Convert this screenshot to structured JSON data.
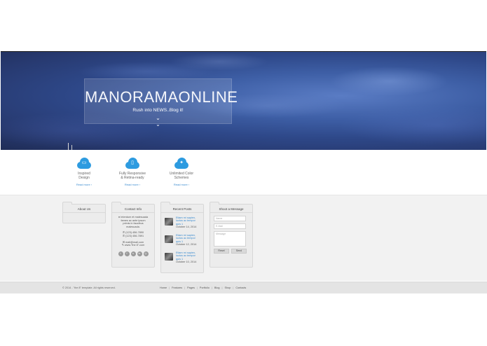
{
  "hero": {
    "title": "MANORAMAONLINE",
    "tagline": "Rush into NEWS..Blog it!",
    "chevron": "chevron-down-double"
  },
  "features": [
    {
      "icon": "laptop-icon",
      "label_line1": "Inspired",
      "label_line2": "Design",
      "read_more": "Read more ›"
    },
    {
      "icon": "tablet-icon",
      "label_line1": "Fully Responsive",
      "label_line2": "& Retina-ready",
      "read_more": "Read more ›"
    },
    {
      "icon": "magic-wand-icon",
      "label_line1": "Unlimited Color",
      "label_line2": "Schemes",
      "read_more": "Read more ›"
    }
  ],
  "widgets": {
    "about": {
      "title": "About Us"
    },
    "contact": {
      "title": "Contact Info",
      "address_line1": "Interdum et malesuada",
      "address_line2": "fames ac ante ipsum",
      "address_line3": "primis in faucibus",
      "address_line4": "malesuada.",
      "phone1": "(123) 456-7890",
      "phone2": "(123) 456-7891",
      "email": "mail@mail.com",
      "website": "www.\"the 8\".com",
      "socials": [
        "twitter-icon",
        "facebook-icon",
        "skype-icon",
        "linkedin-icon",
        "dribbble-icon"
      ]
    },
    "posts": {
      "title": "Recent Posts",
      "items": [
        {
          "title": "Etiam mi sapien, luctus ac tempor quis 1",
          "date": "October 14, 2014"
        },
        {
          "title": "Etiam mi sapien, luctus ac tempor quis 1",
          "date": "October 12, 2014"
        },
        {
          "title": "Etiam mi sapien, luctus ac tempor quis 1",
          "date": "October 10, 2014"
        }
      ]
    },
    "message": {
      "title": "Shoot a Message",
      "name_placeholder": "Name",
      "mail_placeholder": "E-Mail",
      "message_placeholder": "Message",
      "reset_label": "Reset",
      "send_label": "Send"
    }
  },
  "footer": {
    "copyright": "© 2014 - \"the 8\" template. All rights reserved.",
    "nav": [
      "Home",
      "Features",
      "Pages",
      "Portfolio",
      "Blog",
      "Shop",
      "Contacts"
    ]
  },
  "colors": {
    "accent": "#2d9be0",
    "link": "#3a8bd0"
  }
}
